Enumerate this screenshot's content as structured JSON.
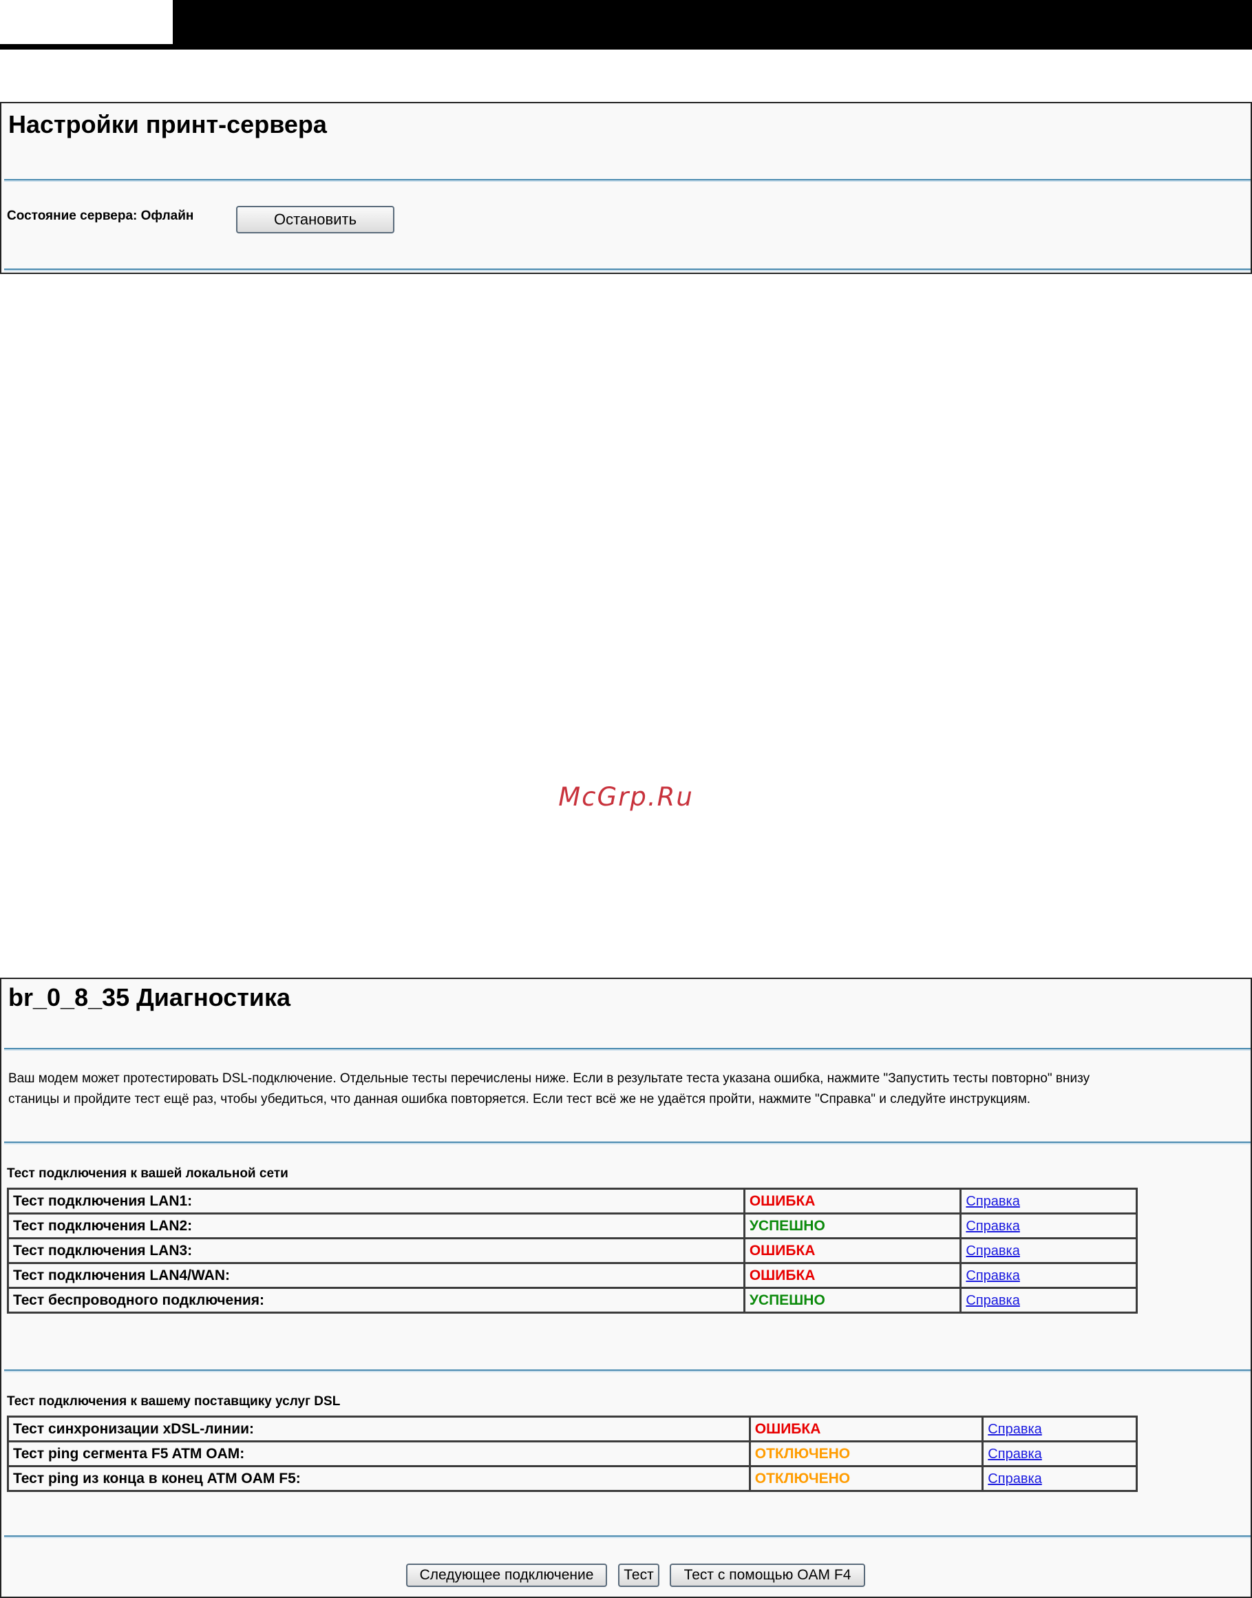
{
  "print_server": {
    "title": "Настройки принт-сервера",
    "status_label": "Состояние сервера: Офлайн",
    "stop_button": "Остановить"
  },
  "watermark": "McGrp.Ru",
  "diagnostics": {
    "title": "br_0_8_35 Диагностика",
    "intro_line1": "Ваш модем может протестировать DSL-подключение. Отдельные тесты перечислены ниже. Если в результате теста указана ошибка, нажмите \"Запустить тесты повторно\" внизу",
    "intro_line2": "станицы и пройдите тест ещё раз, чтобы убедиться, что данная ошибка повторяется. Если тест всё же не удаётся пройти, нажмите \"Справка\" и следуйте инструкциям.",
    "lan_section_title": "Тест подключения к вашей локальной сети",
    "lan_tests": [
      {
        "name": "Тест подключения LAN1:",
        "status": "ОШИБКА",
        "help": "Справка"
      },
      {
        "name": "Тест подключения LAN2:",
        "status": "УСПЕШНО",
        "help": "Справка"
      },
      {
        "name": "Тест подключения LAN3:",
        "status": "ОШИБКА",
        "help": "Справка"
      },
      {
        "name": "Тест подключения LAN4/WAN:",
        "status": "ОШИБКА",
        "help": "Справка"
      },
      {
        "name": "Тест беспроводного подключения:",
        "status": "УСПЕШНО",
        "help": "Справка"
      }
    ],
    "dsl_section_title": "Тест подключения к вашему поставщику услуг DSL",
    "dsl_tests": [
      {
        "name": "Тест синхронизации xDSL-линии:",
        "status": "ОШИБКА",
        "help": "Справка"
      },
      {
        "name": "Тест ping сегмента F5 ATM OAM:",
        "status": "ОТКЛЮЧЕНО",
        "help": "Справка"
      },
      {
        "name": "Тест ping из конца в конец ATM OAM F5:",
        "status": "ОТКЛЮЧЕНО",
        "help": "Справка"
      }
    ],
    "buttons": {
      "next_connection": "Следующее подключение",
      "test": "Тест",
      "test_oam_f4": "Тест с помощью OAM F4"
    }
  },
  "colors": {
    "error": "#e80000",
    "success": "#0b8a0b",
    "disabled": "#ff9c00",
    "link": "#1a1adf",
    "divider": "#4b8bb0"
  }
}
